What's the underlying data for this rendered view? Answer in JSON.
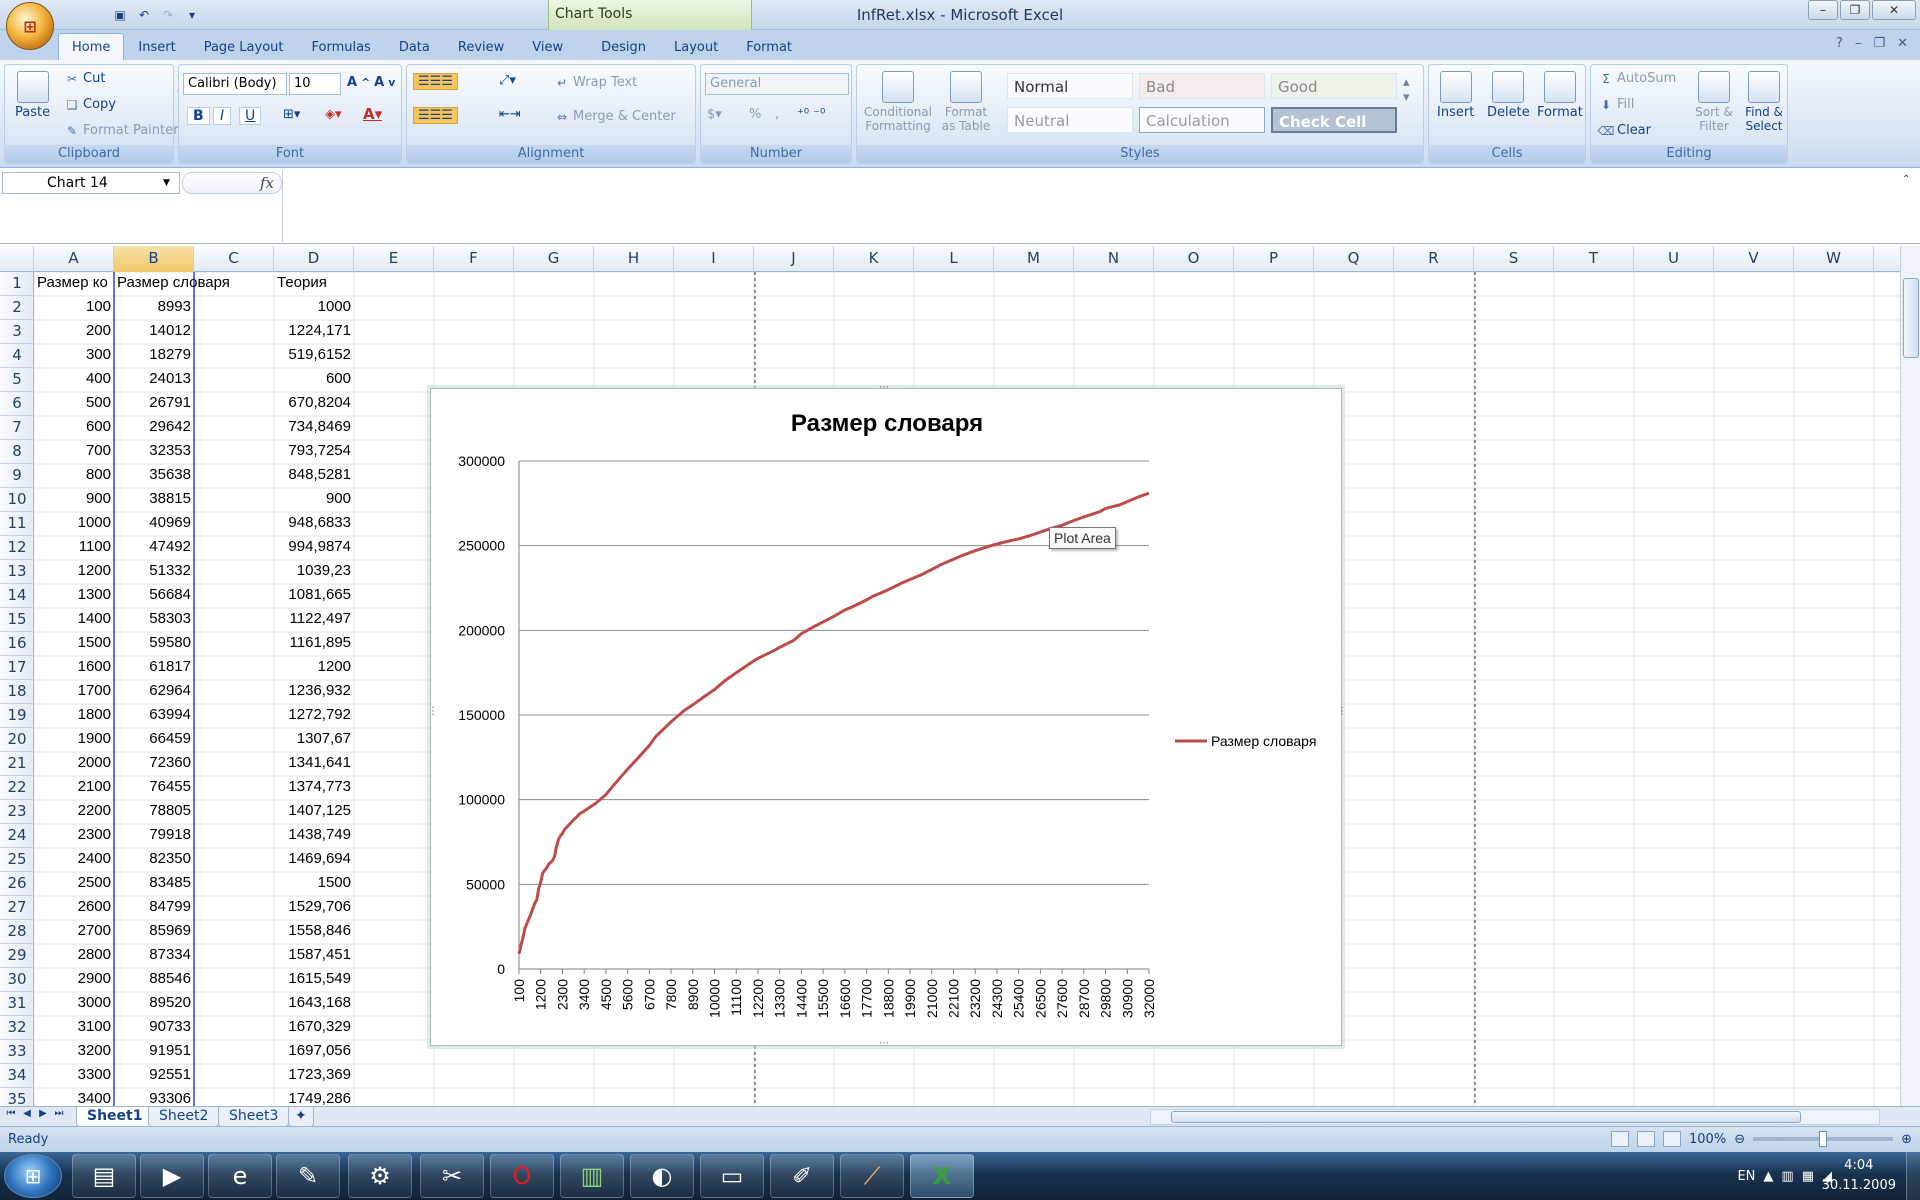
{
  "window": {
    "title": "InfRet.xlsx - Microsoft Excel",
    "chart_tools": "Chart Tools"
  },
  "office_button": "⊞",
  "qat": [
    "save-icon",
    "undo-icon",
    "redo-icon",
    "customize-icon"
  ],
  "tabs": [
    "Home",
    "Insert",
    "Page Layout",
    "Formulas",
    "Data",
    "Review",
    "View",
    "Design",
    "Layout",
    "Format"
  ],
  "ribbon": {
    "clipboard": {
      "paste": "Paste",
      "cut": "Cut",
      "copy": "Copy",
      "format_painter": "Format Painter",
      "label": "Clipboard"
    },
    "font": {
      "name": "Calibri (Body)",
      "size": "10",
      "label": "Font",
      "bold": "B",
      "italic": "I",
      "underline": "U"
    },
    "alignment": {
      "wrap": "Wrap Text",
      "merge": "Merge & Center",
      "label": "Alignment"
    },
    "number": {
      "format": "General",
      "label": "Number",
      "percent": "%"
    },
    "styles": {
      "cond": "Conditional Formatting",
      "table": "Format as Table",
      "normal": "Normal",
      "bad": "Bad",
      "good": "Good",
      "neutral": "Neutral",
      "calculation": "Calculation",
      "check": "Check Cell",
      "label": "Styles"
    },
    "cells": {
      "insert": "Insert",
      "delete": "Delete",
      "format": "Format",
      "label": "Cells"
    },
    "editing": {
      "autosum": "AutoSum",
      "fill": "Fill",
      "clear": "Clear",
      "sort": "Sort & Filter",
      "find": "Find & Select",
      "label": "Editing"
    }
  },
  "namebox": "Chart 14",
  "fx": "fx",
  "columns": [
    "A",
    "B",
    "C",
    "D",
    "E",
    "F",
    "G",
    "H",
    "I",
    "J",
    "K",
    "L",
    "M",
    "N",
    "O",
    "P",
    "Q",
    "R",
    "S",
    "T",
    "U",
    "V",
    "W"
  ],
  "headers": {
    "a1": "Размер ко",
    "b1": "Размер словаря",
    "d1": "Теория"
  },
  "rows": [
    [
      "100",
      "8993",
      "1000"
    ],
    [
      "200",
      "14012",
      "1224,171"
    ],
    [
      "300",
      "18279",
      "519,6152"
    ],
    [
      "400",
      "24013",
      "600"
    ],
    [
      "500",
      "26791",
      "670,8204"
    ],
    [
      "600",
      "29642",
      "734,8469"
    ],
    [
      "700",
      "32353",
      "793,7254"
    ],
    [
      "800",
      "35638",
      "848,5281"
    ],
    [
      "900",
      "38815",
      "900"
    ],
    [
      "1000",
      "40969",
      "948,6833"
    ],
    [
      "1100",
      "47492",
      "994,9874"
    ],
    [
      "1200",
      "51332",
      "1039,23"
    ],
    [
      "1300",
      "56684",
      "1081,665"
    ],
    [
      "1400",
      "58303",
      "1122,497"
    ],
    [
      "1500",
      "59580",
      "1161,895"
    ],
    [
      "1600",
      "61817",
      "1200"
    ],
    [
      "1700",
      "62964",
      "1236,932"
    ],
    [
      "1800",
      "63994",
      "1272,792"
    ],
    [
      "1900",
      "66459",
      "1307,67"
    ],
    [
      "2000",
      "72360",
      "1341,641"
    ],
    [
      "2100",
      "76455",
      "1374,773"
    ],
    [
      "2200",
      "78805",
      "1407,125"
    ],
    [
      "2300",
      "79918",
      "1438,749"
    ],
    [
      "2400",
      "82350",
      "1469,694"
    ],
    [
      "2500",
      "83485",
      "1500"
    ],
    [
      "2600",
      "84799",
      "1529,706"
    ],
    [
      "2700",
      "85969",
      "1558,846"
    ],
    [
      "2800",
      "87334",
      "1587,451"
    ],
    [
      "2900",
      "88546",
      "1615,549"
    ],
    [
      "3000",
      "89520",
      "1643,168"
    ],
    [
      "3100",
      "90733",
      "1670,329"
    ],
    [
      "3200",
      "91951",
      "1697,056"
    ],
    [
      "3300",
      "92551",
      "1723,369"
    ],
    [
      "3400",
      "93306",
      "1749,286"
    ]
  ],
  "row_numbers": [
    "1",
    "2",
    "3",
    "4",
    "5",
    "6",
    "7",
    "8",
    "9",
    "10",
    "11",
    "12",
    "13",
    "14",
    "15",
    "16",
    "17",
    "18",
    "19",
    "20",
    "21",
    "22",
    "23",
    "24",
    "25",
    "26",
    "27",
    "28",
    "29",
    "30",
    "31",
    "32",
    "33",
    "34",
    "35"
  ],
  "sheets": [
    "Sheet1",
    "Sheet2",
    "Sheet3"
  ],
  "status": {
    "text": "Ready",
    "zoom": "100%"
  },
  "taskbar": {
    "lang": "EN",
    "time": "4:04",
    "date": "30.11.2009"
  },
  "tooltip": "Plot Area",
  "chart_data": {
    "type": "line",
    "title": "Размер словаря",
    "xlabel": "",
    "ylabel": "",
    "ylim": [
      0,
      300000
    ],
    "y_ticks": [
      "0",
      "50000",
      "100000",
      "150000",
      "200000",
      "250000",
      "300000"
    ],
    "x_tick_labels": [
      "100",
      "1200",
      "2300",
      "3400",
      "4500",
      "5600",
      "6700",
      "7800",
      "8900",
      "10000",
      "11100",
      "12200",
      "13300",
      "14400",
      "15500",
      "16600",
      "17700",
      "18800",
      "19900",
      "21000",
      "22100",
      "23200",
      "24300",
      "25400",
      "26500",
      "27600",
      "28700",
      "29800",
      "30900",
      "32000"
    ],
    "grid": true,
    "legend": "right",
    "color": "#be4b48",
    "series": [
      {
        "name": "Размер словаря",
        "x": [
          100,
          200,
          300,
          400,
          500,
          600,
          700,
          800,
          900,
          1000,
          1100,
          1200,
          1300,
          1400,
          1500,
          1600,
          1700,
          1800,
          1900,
          2000,
          2100,
          2200,
          2300,
          2400,
          2500,
          2600,
          2700,
          2800,
          2900,
          3000,
          3100,
          3200,
          3300,
          3400,
          4000,
          4500,
          5000,
          5600,
          6000,
          6700,
          7000,
          7800,
          8500,
          8900,
          9500,
          10000,
          10500,
          11100,
          12000,
          12200,
          13000,
          13300,
          14000,
          14400,
          15000,
          15500,
          16000,
          16600,
          17000,
          17700,
          18000,
          18800,
          19500,
          19900,
          20500,
          21000,
          21500,
          22100,
          22500,
          23200,
          24000,
          24300,
          25000,
          25400,
          26000,
          26500,
          27000,
          27600,
          28000,
          28700,
          29500,
          29800,
          30500,
          30900,
          31500,
          32000
        ],
        "values": [
          8993,
          14012,
          18279,
          24013,
          26791,
          29642,
          32353,
          35638,
          38815,
          40969,
          47492,
          51332,
          56684,
          58303,
          59580,
          61817,
          62964,
          63994,
          66459,
          72360,
          76455,
          78805,
          79918,
          82350,
          83485,
          84799,
          85969,
          87334,
          88546,
          89520,
          90733,
          91951,
          92551,
          93306,
          98000,
          103000,
          110000,
          118000,
          123000,
          132000,
          137000,
          146000,
          153000,
          156000,
          161000,
          165000,
          170000,
          175000,
          182000,
          183500,
          188000,
          190000,
          194000,
          198000,
          202000,
          205000,
          208000,
          212000,
          214000,
          218000,
          220000,
          224000,
          228000,
          230000,
          233000,
          236000,
          239000,
          242000,
          244000,
          247000,
          250000,
          251000,
          253000,
          254000,
          256000,
          258000,
          260000,
          262000,
          264000,
          267000,
          270000,
          272000,
          274000,
          276000,
          279000,
          281000
        ]
      }
    ]
  }
}
